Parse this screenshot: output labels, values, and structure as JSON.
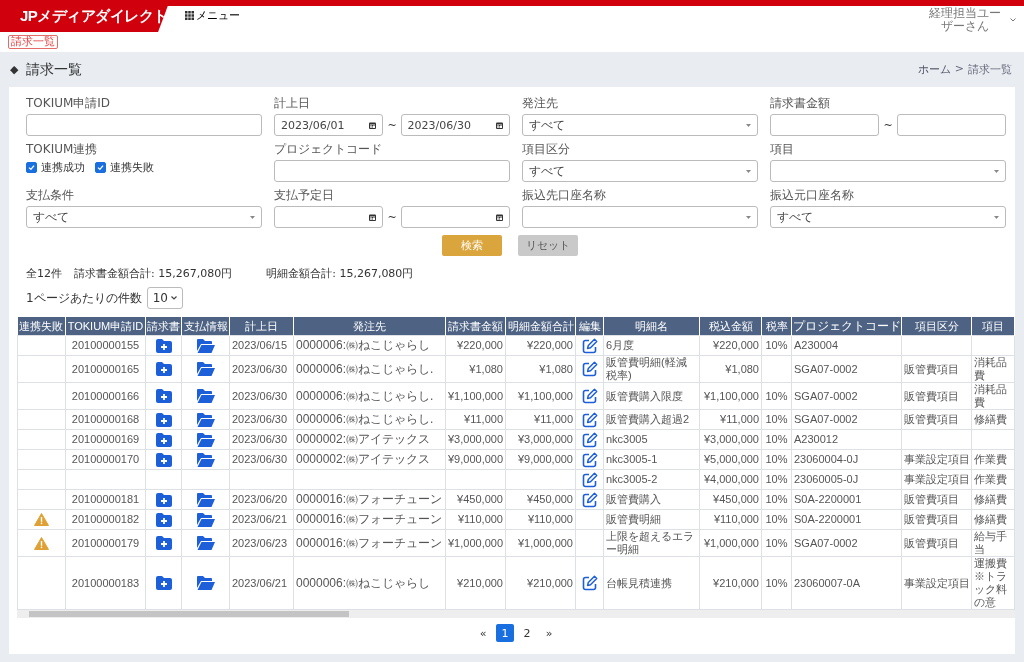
{
  "header": {
    "logo": "JPメディアダイレクト",
    "menu": "メニュー",
    "user": "経理担当ユーザーさん"
  },
  "page_badge": "請求一覧",
  "title": {
    "mark": "◆",
    "text": "請求一覧"
  },
  "breadcrumb": {
    "home": "ホーム",
    "separator": ">",
    "current": "請求一覧"
  },
  "filters": [
    {
      "kind": "text",
      "label": "TOKIUM申請ID"
    },
    {
      "kind": "date_range",
      "label": "計上日",
      "from": "2023/06/01",
      "to": "2023/06/30",
      "separator": "~"
    },
    {
      "kind": "select",
      "label": "発注先",
      "value": "すべて"
    },
    {
      "kind": "amount_range",
      "label": "請求書金額",
      "separator": "~"
    },
    {
      "kind": "checkboxes",
      "label": "TOKIUM連携",
      "options": [
        {
          "label": "連携成功",
          "checked": true
        },
        {
          "label": "連携失敗",
          "checked": true
        }
      ]
    },
    {
      "kind": "text",
      "label": "プロジェクトコード"
    },
    {
      "kind": "select",
      "label": "項目区分",
      "value": "すべて"
    },
    {
      "kind": "select",
      "label": "項目"
    },
    {
      "kind": "select",
      "label": "支払条件",
      "value": "すべて"
    },
    {
      "kind": "date_range",
      "label": "支払予定日",
      "separator": "~"
    },
    {
      "kind": "select",
      "label": "振込先口座名称"
    },
    {
      "kind": "select",
      "label": "振込元口座名称",
      "value": "すべて"
    }
  ],
  "buttons": [
    {
      "kind": "primary",
      "label": "検索"
    },
    {
      "kind": "secondary",
      "label": "リセット"
    }
  ],
  "summary": {
    "count": "全12件",
    "invoice_total": "請求書金額合計: 15,267,080円",
    "detail_total": "明細金額合計: 15,267,080円"
  },
  "per_page": {
    "label": "1ページあたりの件数",
    "value": "10"
  },
  "table": {
    "columns": [
      "連携失敗",
      "TOKIUM申請ID",
      "請求書",
      "支払情報",
      "計上日",
      "発注先",
      "請求書金額",
      "明細金額合計",
      "編集",
      "明細名",
      "税込金額",
      "税率",
      "プロジェクトコード",
      "項目区分",
      "項目"
    ],
    "rows": [
      {
        "sync_failed": false,
        "id": "20100000155",
        "invoice": true,
        "payment": true,
        "date": "2023/06/15",
        "vendor": "0000006:㈱ねこじゃらし",
        "invoice_amount": "¥220,000",
        "detail_total": "¥220,000",
        "editable": true,
        "detail": "6月度",
        "tax_incl": "¥220,000",
        "tax_rate": "10%",
        "project": "A230004"
      },
      {
        "sync_failed": false,
        "id": "20100000165",
        "invoice": true,
        "payment": true,
        "date": "2023/06/30",
        "vendor": "0000006:㈱ねこじゃらし.",
        "invoice_amount": "¥1,080",
        "detail_total": "¥1,080",
        "editable": true,
        "detail": "販管費明細(軽減税率)",
        "tax_incl": "¥1,080",
        "project": "SGA07-0002",
        "category": "販管費項目",
        "item": "消耗品費"
      },
      {
        "sync_failed": false,
        "id": "20100000166",
        "invoice": true,
        "payment": true,
        "date": "2023/06/30",
        "vendor": "0000006:㈱ねこじゃらし.",
        "invoice_amount": "¥1,100,000",
        "detail_total": "¥1,100,000",
        "editable": true,
        "detail": "販管費購入限度",
        "tax_incl": "¥1,100,000",
        "tax_rate": "10%",
        "project": "SGA07-0002",
        "category": "販管費項目",
        "item": "消耗品費"
      },
      {
        "sync_failed": false,
        "id": "20100000168",
        "invoice": true,
        "payment": true,
        "date": "2023/06/30",
        "vendor": "0000006:㈱ねこじゃらし.",
        "invoice_amount": "¥11,000",
        "detail_total": "¥11,000",
        "editable": true,
        "detail": "販管費購入超過2",
        "tax_incl": "¥11,000",
        "tax_rate": "10%",
        "project": "SGA07-0002",
        "category": "販管費項目",
        "item": "修繕費"
      },
      {
        "sync_failed": false,
        "id": "20100000169",
        "invoice": true,
        "payment": true,
        "date": "2023/06/30",
        "vendor": "0000002:㈱アイテックス",
        "invoice_amount": "¥3,000,000",
        "detail_total": "¥3,000,000",
        "editable": true,
        "detail": "nkc3005",
        "tax_incl": "¥3,000,000",
        "tax_rate": "10%",
        "project": "A230012"
      },
      {
        "sync_failed": false,
        "id": "20100000170",
        "invoice": true,
        "payment": true,
        "date": "2023/06/30",
        "vendor": "0000002:㈱アイテックス",
        "invoice_amount": "¥9,000,000",
        "detail_total": "¥9,000,000",
        "editable": true,
        "detail": "nkc3005-1",
        "tax_incl": "¥5,000,000",
        "tax_rate": "10%",
        "project": "23060004-0J",
        "category": "事業設定項目",
        "item": "作業費"
      },
      {
        "sync_failed": false,
        "invoice": false,
        "payment": false,
        "editable": true,
        "detail": "nkc3005-2",
        "tax_incl": "¥4,000,000",
        "tax_rate": "10%",
        "project": "23060005-0J",
        "category": "事業設定項目",
        "item": "作業費"
      },
      {
        "sync_failed": false,
        "id": "20100000181",
        "invoice": true,
        "payment": true,
        "date": "2023/06/20",
        "vendor": "0000016:㈱フォーチューン",
        "invoice_amount": "¥450,000",
        "detail_total": "¥450,000",
        "editable": true,
        "detail": "販管費購入",
        "tax_incl": "¥450,000",
        "tax_rate": "10%",
        "project": "S0A-2200001",
        "category": "販管費項目",
        "item": "修繕費"
      },
      {
        "sync_failed": true,
        "id": "20100000182",
        "invoice": true,
        "payment": true,
        "date": "2023/06/21",
        "vendor": "0000016:㈱フォーチューン",
        "invoice_amount": "¥110,000",
        "detail_total": "¥110,000",
        "editable": false,
        "detail": "販管費明細",
        "tax_incl": "¥110,000",
        "tax_rate": "10%",
        "project": "S0A-2200001",
        "category": "販管費項目",
        "item": "修繕費"
      },
      {
        "sync_failed": true,
        "id": "20100000179",
        "invoice": true,
        "payment": true,
        "date": "2023/06/23",
        "vendor": "0000016:㈱フォーチューン",
        "invoice_amount": "¥1,000,000",
        "detail_total": "¥1,000,000",
        "editable": false,
        "detail": "上限を超えるエラー明細",
        "tax_incl": "¥1,000,000",
        "tax_rate": "10%",
        "project": "SGA07-0002",
        "category": "販管費項目",
        "item": "給与手当"
      },
      {
        "sync_failed": false,
        "id": "20100000183",
        "invoice": true,
        "payment": true,
        "date": "2023/06/21",
        "vendor": "0000006:㈱ねこじゃらし",
        "invoice_amount": "¥210,000",
        "detail_total": "¥210,000",
        "editable": true,
        "detail": "台帳見積連携",
        "tax_incl": "¥210,000",
        "tax_rate": "10%",
        "project": "23060007-0A",
        "category": "事業設定項目",
        "item": "運搬費 ※トラック料の意"
      }
    ]
  },
  "pagination": {
    "prev": "«",
    "pages": [
      {
        "label": "1",
        "selected": true
      },
      {
        "label": "2",
        "selected": false
      }
    ],
    "next": "»"
  }
}
